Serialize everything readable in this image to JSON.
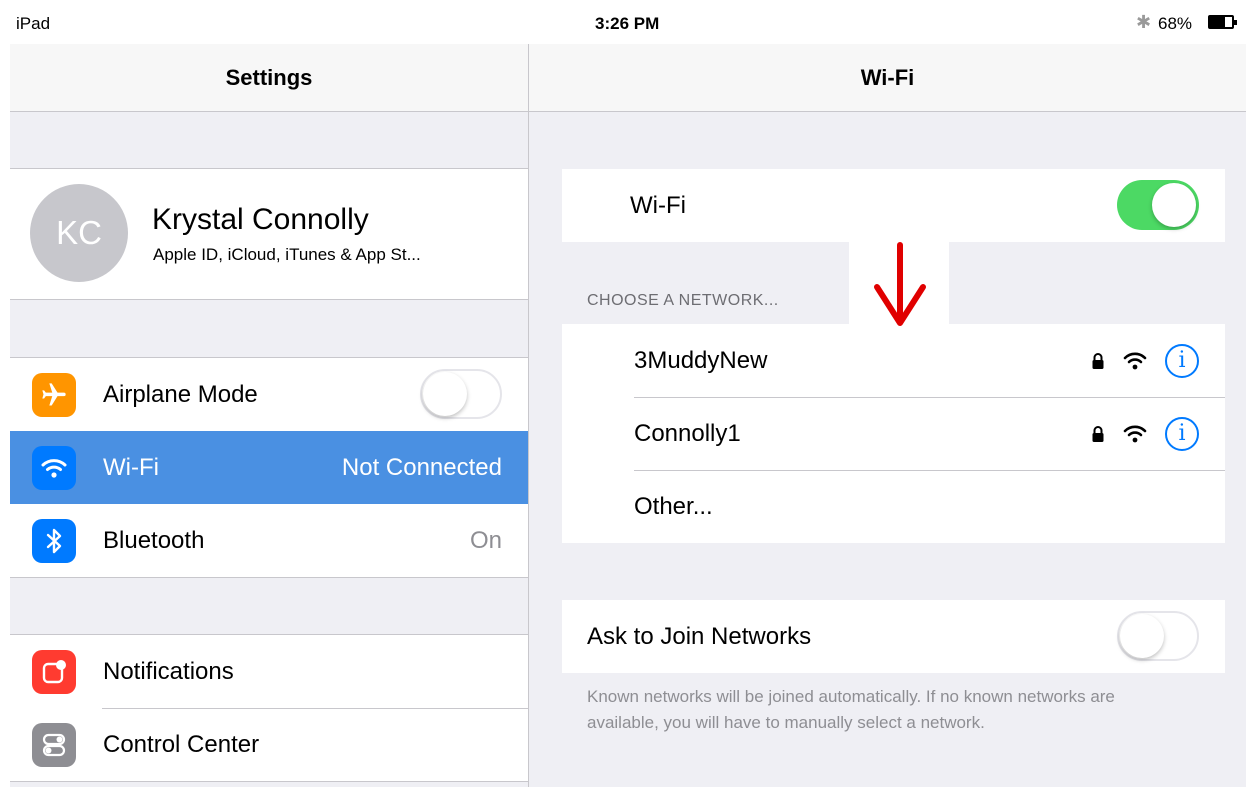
{
  "status_bar": {
    "device": "iPad",
    "time": "3:26 PM",
    "bluetooth_icon": "bluetooth-icon",
    "battery_percent": "68%",
    "battery_level": 0.68
  },
  "left": {
    "title": "Settings",
    "profile": {
      "initials": "KC",
      "name": "Krystal Connolly",
      "subtitle": "Apple ID, iCloud, iTunes & App St..."
    },
    "group1": [
      {
        "label": "Airplane Mode",
        "icon": "airplane-icon",
        "color": "#ff9500",
        "toggle": "off"
      },
      {
        "label": "Wi-Fi",
        "value": "Not Connected",
        "icon": "wifi-icon",
        "color": "#007aff",
        "selected": true
      },
      {
        "label": "Bluetooth",
        "value": "On",
        "icon": "bluetooth-icon",
        "color": "#007aff"
      }
    ],
    "group2": [
      {
        "label": "Notifications",
        "icon": "notifications-icon",
        "color": "#ff3b30"
      },
      {
        "label": "Control Center",
        "icon": "control-center-icon",
        "color": "#8e8e93"
      }
    ]
  },
  "right": {
    "title": "Wi-Fi",
    "wifi_row": {
      "label": "Wi-Fi",
      "toggle": "on"
    },
    "section_header": "CHOOSE A NETWORK...",
    "networks": [
      {
        "name": "3MuddyNew",
        "locked": true,
        "info": "i"
      },
      {
        "name": "Connolly1",
        "locked": true,
        "info": "i"
      }
    ],
    "other": "Other...",
    "ask_join": {
      "label": "Ask to Join Networks",
      "toggle": "off"
    },
    "footer_note": "Known networks will be joined automatically. If no known networks are available, you will have to manually select a network."
  },
  "annotation": {
    "icon": "red-down-arrow-icon",
    "color": "#e00000"
  },
  "colors": {
    "selected_row": "#4a90e2",
    "toggle_on": "#4cd964",
    "info_blue": "#007aff"
  }
}
